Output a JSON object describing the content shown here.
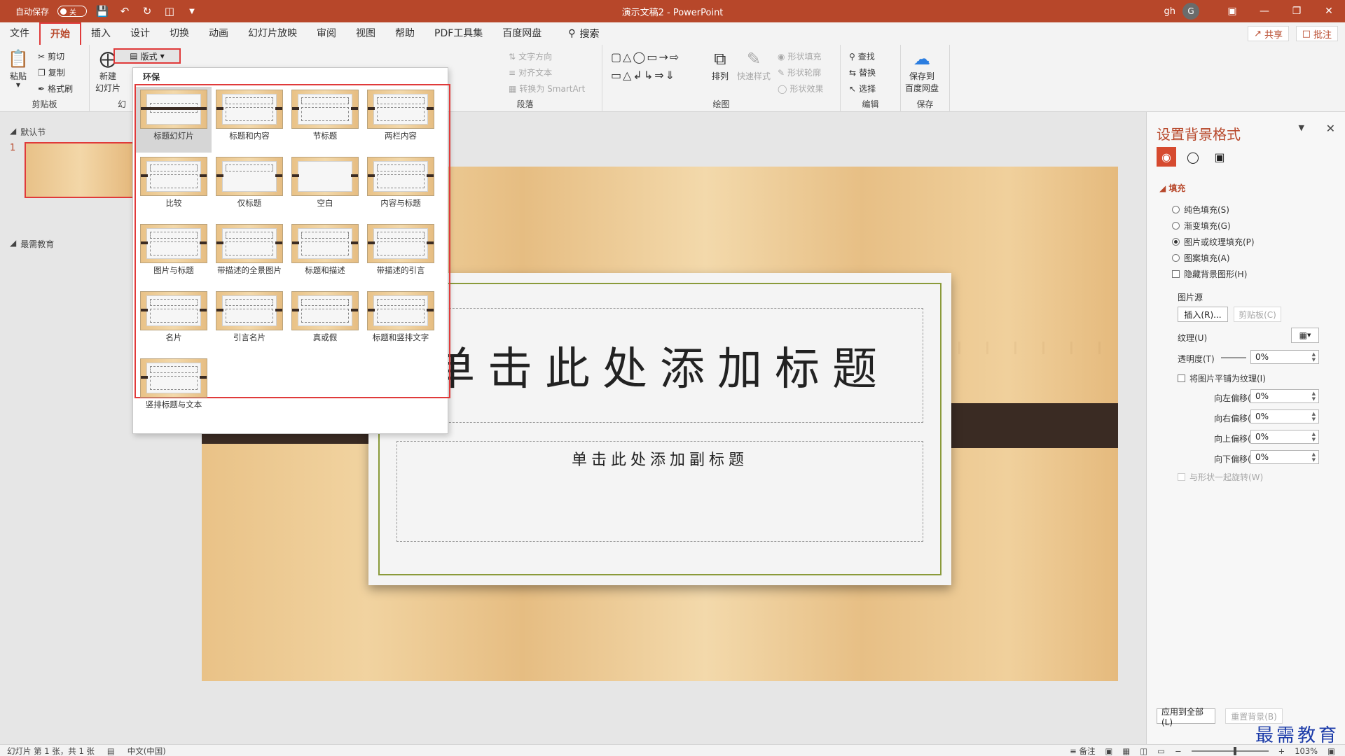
{
  "titlebar": {
    "autosave_label": "自动保存",
    "autosave_state": "关",
    "doc_title": "演示文稿2  -  PowerPoint",
    "user": "gh",
    "avatar_letter": "G"
  },
  "tabs": [
    "文件",
    "开始",
    "插入",
    "设计",
    "切换",
    "动画",
    "幻灯片放映",
    "审阅",
    "视图",
    "帮助",
    "PDF工具集",
    "百度网盘"
  ],
  "active_tab": "开始",
  "search_label": "搜索",
  "share_label": "共享",
  "comment_label": "批注",
  "ribbon": {
    "paste": "粘贴",
    "cut": "剪切",
    "copy": "复制",
    "format_painter": "格式刷",
    "clipboard_group": "剪贴板",
    "new_slide_1": "新建",
    "new_slide_2": "幻灯片",
    "slides_group": "幻",
    "layout_btn": "版式",
    "text_direction": "文字方向",
    "align_text": "对齐文本",
    "convert_smartart": "转换为 SmartArt",
    "paragraph_group": "段落",
    "arrange": "排列",
    "quick_styles": "快速样式",
    "shape_fill": "形状填充",
    "shape_outline": "形状轮廓",
    "shape_effects": "形状效果",
    "drawing_group": "绘图",
    "find": "查找",
    "replace": "替换",
    "select": "选择",
    "editing_group": "编辑",
    "save_baidu_1": "保存到",
    "save_baidu_2": "百度网盘",
    "save_group": "保存"
  },
  "thumb_panel": {
    "section_default": "默认节",
    "slide_number": "1",
    "section_edu": "最需教育"
  },
  "slide": {
    "title_placeholder": "单击此处添加标题",
    "subtitle_placeholder": "单击此处添加副标题"
  },
  "layout_menu": {
    "theme_name": "环保",
    "layouts": [
      "标题幻灯片",
      "标题和内容",
      "节标题",
      "两栏内容",
      "比较",
      "仅标题",
      "空白",
      "内容与标题",
      "图片与标题",
      "带描述的全景图片",
      "标题和描述",
      "带描述的引言",
      "名片",
      "引言名片",
      "真或假",
      "标题和竖排文字",
      "竖排标题与文本"
    ],
    "selected": "标题幻灯片"
  },
  "format_panel": {
    "title": "设置背景格式",
    "fill_section": "填充",
    "solid_fill": "纯色填充(S)",
    "gradient_fill": "渐变填充(G)",
    "picture_fill": "图片或纹理填充(P)",
    "pattern_fill": "图案填充(A)",
    "hide_bg": "隐藏背景图形(H)",
    "picture_source": "图片源",
    "insert_btn": "插入(R)...",
    "clipboard_btn": "剪贴板(C)",
    "texture": "纹理(U)",
    "transparency": "透明度(T)",
    "transparency_value": "0%",
    "tile": "将图片平铺为纹理(I)",
    "offset_left": "向左偏移(L)",
    "offset_left_value": "0%",
    "offset_right": "向右偏移(R)",
    "offset_right_value": "0%",
    "offset_top": "向上偏移(O)",
    "offset_top_value": "0%",
    "offset_bottom": "向下偏移(M)",
    "offset_bottom_value": "0%",
    "rotate_with_shape": "与形状一起旋转(W)",
    "apply_all": "应用到全部(L)",
    "reset_bg": "重置背景(B)"
  },
  "statusbar": {
    "slide_info": "幻灯片 第 1 张，共 1 张",
    "language": "中文(中国)",
    "notes": "备注",
    "zoom": "103%"
  },
  "watermark": "最需教育",
  "colors": {
    "accent": "#b7472a",
    "highlight_red": "#e03a3a",
    "wood": "#ecc993",
    "dark_band": "#3a2b23"
  }
}
